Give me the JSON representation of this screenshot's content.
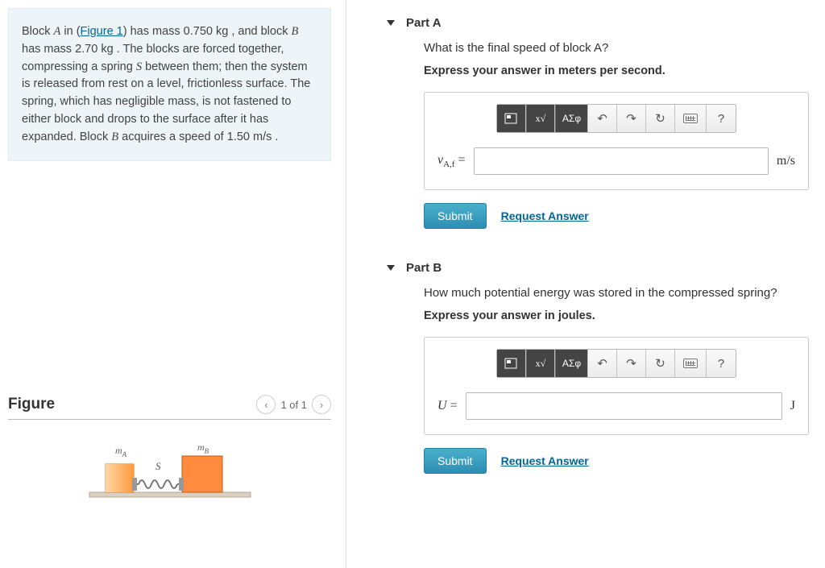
{
  "problem": {
    "html_parts": {
      "p1a": "Block ",
      "A": "A",
      "p1b": " in (",
      "fig_link": "Figure 1",
      "p1c": ") has mass 0.750 ",
      "kg1": "kg",
      "p1d": " , and block ",
      "B": "B",
      "p1e": " has mass 2.70 ",
      "kg2": "kg",
      "p1f": " . The blocks are forced together, compressing a spring ",
      "S": "S",
      "p1g": " between them; then the system is released from rest on a level, frictionless surface. The spring, which has negligible mass, is not fastened to either block and drops to the surface after it has expanded. Block ",
      "B2": "B",
      "p1h": " acquires a speed of 1.50 ",
      "ms": "m/s",
      "p1i": " ."
    }
  },
  "figure": {
    "title": "Figure",
    "nav_text": "1 of 1",
    "labels": {
      "ma": "m",
      "ma_sub": "A",
      "mb": "m",
      "mb_sub": "B",
      "S": "S"
    }
  },
  "parts": [
    {
      "label": "Part A",
      "question": "What is the final speed of block A?",
      "instruction": "Express your answer in meters per second.",
      "var_label_html": {
        "pre": "v",
        "sub": "A,f",
        "eq": " ="
      },
      "unit": "m/s",
      "submit": "Submit",
      "request": "Request Answer",
      "toolbar": {
        "greek": "ΑΣφ",
        "help": "?"
      }
    },
    {
      "label": "Part B",
      "question": "How much potential energy was stored in the compressed spring?",
      "instruction": "Express your answer in joules.",
      "var_label_html": {
        "pre": "U",
        "sub": "",
        "eq": " ="
      },
      "unit": "J",
      "submit": "Submit",
      "request": "Request Answer",
      "toolbar": {
        "greek": "ΑΣφ",
        "help": "?"
      }
    }
  ]
}
